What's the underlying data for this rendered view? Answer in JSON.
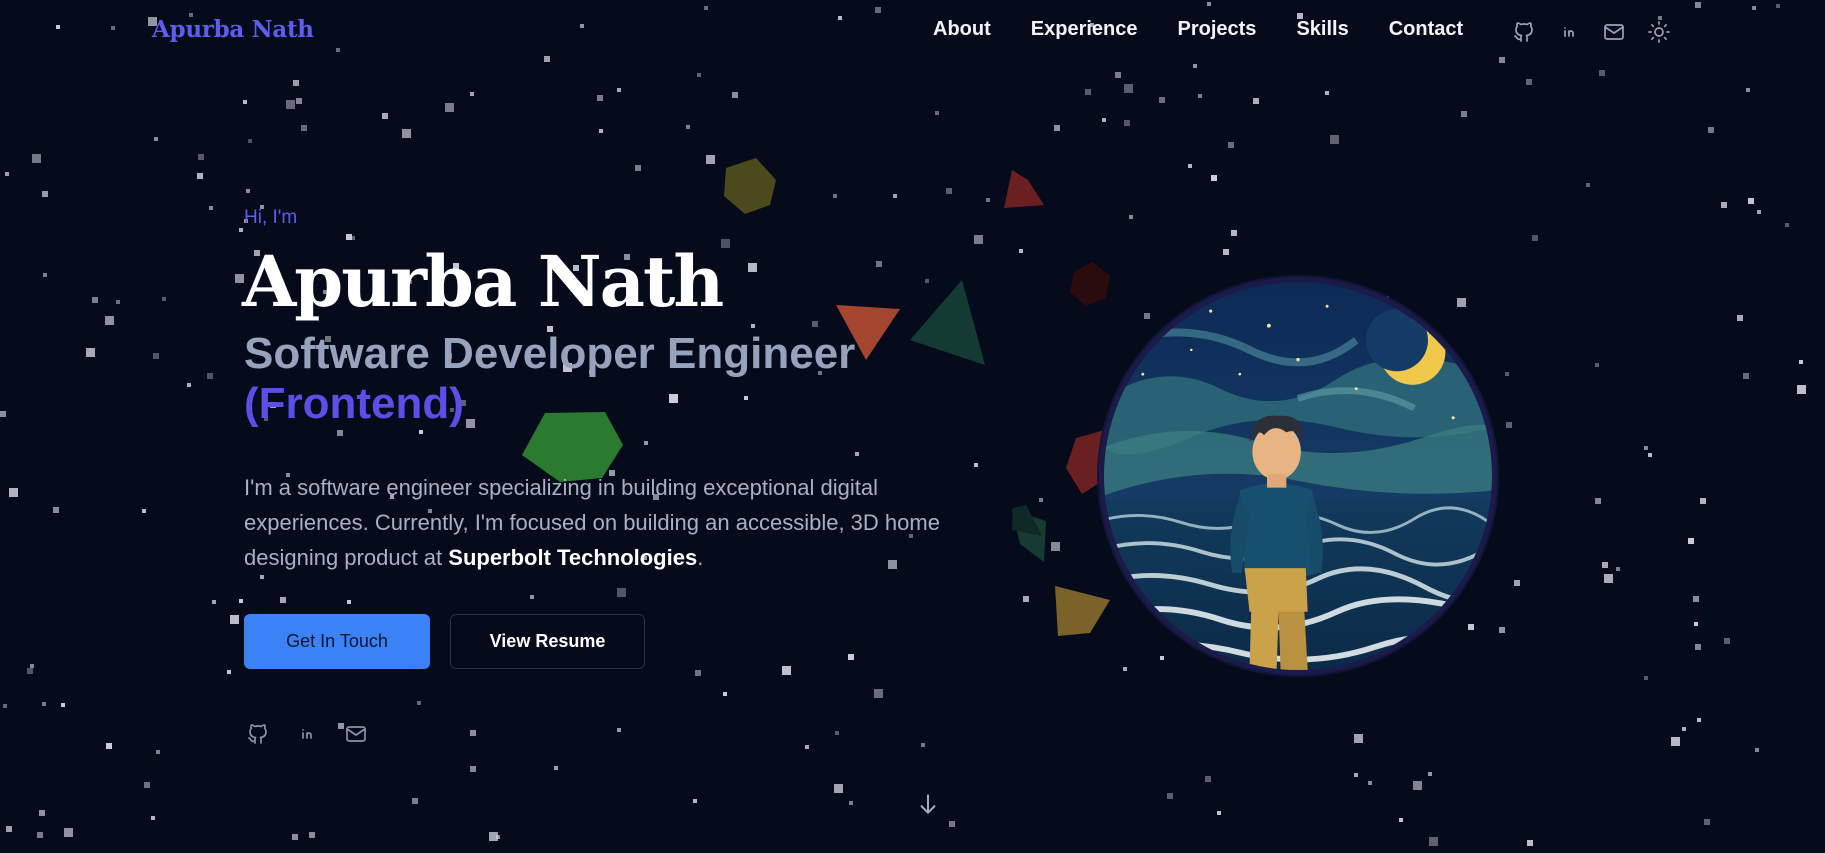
{
  "nav": {
    "logo": "Apurba Nath",
    "links": [
      {
        "label": "About"
      },
      {
        "label": "Experience"
      },
      {
        "label": "Projects"
      },
      {
        "label": "Skills"
      },
      {
        "label": "Contact"
      }
    ],
    "icons": [
      "github-icon",
      "linkedin-icon",
      "mail-icon",
      "sun-icon"
    ]
  },
  "hero": {
    "greeting": "Hi, I'm",
    "name": "Apurba Nath",
    "role": "Software Developer Engineer",
    "role_accent": "(Frontend)",
    "bio_prefix": "I'm a software engineer specializing in building exceptional digital experiences. Currently, I'm focused on building an accessible, 3D home designing product at ",
    "bio_company": "Superbolt Technologies",
    "bio_suffix": ".",
    "primary_button": "Get In Touch",
    "secondary_button": "View Resume",
    "social_icons": [
      "github-icon",
      "linkedin-icon",
      "mail-icon"
    ]
  },
  "scroll_icon": "arrow-down-icon",
  "colors": {
    "background": "#060b1c",
    "accent": "#5b5ff0",
    "primary_button": "#3b82f6",
    "role_text": "#97a3bd"
  }
}
